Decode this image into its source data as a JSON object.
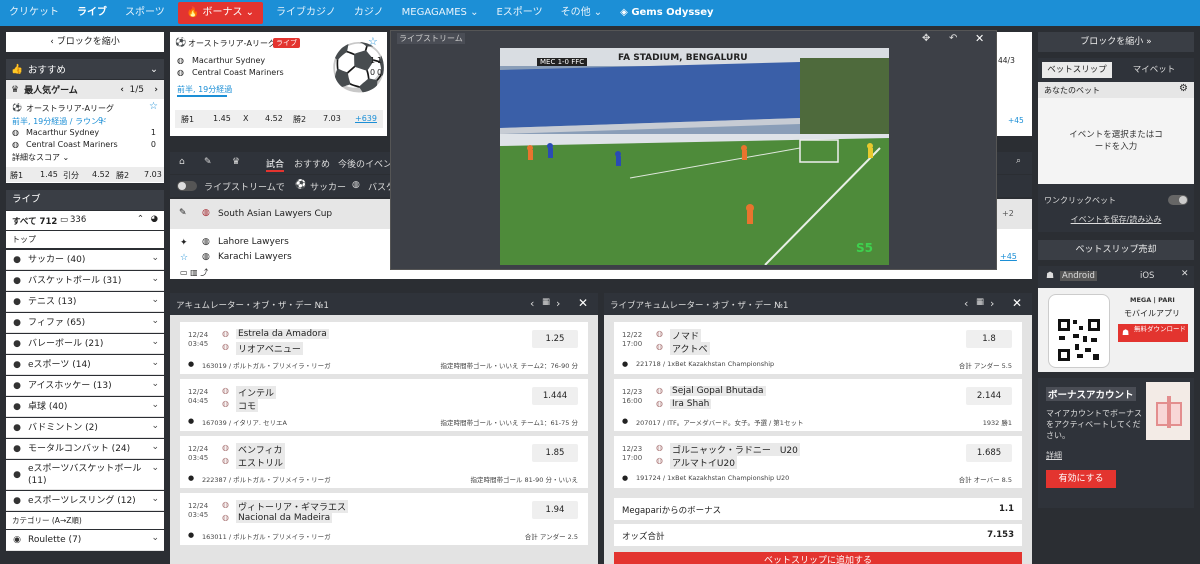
{
  "topnav": {
    "items": [
      "クリケット",
      "ライブ",
      "スポーツ",
      "ボーナス",
      "ライブカジノ",
      "カジノ",
      "MEGAGAMES",
      "Eスポーツ",
      "その他",
      "Gems Odyssey"
    ]
  },
  "left": {
    "shrink_label": "ブロックを縮小",
    "featured_label": "おすすめ",
    "popular_label": "最人気ゲーム",
    "popular_page": "1/5",
    "match": {
      "league": "オーストラリア-Aリーグ",
      "status": "前半, 19分経過 / ラウンド",
      "round": "9",
      "team1": "Macarthur Sydney",
      "team2": "Central Coast Mariners",
      "score1": "1",
      "score2": "0",
      "detail_label": "詳細なスコア",
      "odds": [
        {
          "l": "勝1",
          "v": "1.45"
        },
        {
          "l": "引分",
          "v": "4.52"
        },
        {
          "l": "勝2",
          "v": "7.03"
        }
      ]
    },
    "live_label": "ライブ",
    "all_label": "すべて 712",
    "all_count": "336",
    "top_label": "トップ",
    "sports": [
      {
        "icon": "soccer-icon",
        "label": "サッカー (40)"
      },
      {
        "icon": "basketball-icon",
        "label": "バスケットボール (31)"
      },
      {
        "icon": "tennis-icon",
        "label": "テニス (13)"
      },
      {
        "icon": "fifa-icon",
        "label": "フィファ (65)"
      },
      {
        "icon": "volleyball-icon",
        "label": "バレーボール (21)"
      },
      {
        "icon": "esports-icon",
        "label": "eスポーツ (14)"
      },
      {
        "icon": "icehockey-icon",
        "label": "アイスホッケー (13)"
      },
      {
        "icon": "tabletennis-icon",
        "label": "卓球 (40)"
      },
      {
        "icon": "badminton-icon",
        "label": "バドミントン (2)"
      },
      {
        "icon": "motorsport-icon",
        "label": "モータルコンバット (24)"
      },
      {
        "icon": "esports-basketball-icon",
        "label": "eスポーツバスケットボール (11)"
      },
      {
        "icon": "esports-wrestling-icon",
        "label": "eスポーツレスリング (12)"
      }
    ],
    "category_label": "カテゴリー (A→Z順)",
    "roulette_label": "Roulette (7)"
  },
  "featured": {
    "league": "オーストラリア-Aリーグ",
    "live_badge": "ライブ",
    "team1": "Macarthur Sydney",
    "team2": "Central Coast Mariners",
    "score1a": "1",
    "score1b": "1",
    "score2a": "0",
    "score2b": "0",
    "status": "前半, 19分経過",
    "odds": [
      {
        "l": "勝1",
        "v": "1.45"
      },
      {
        "l": "X",
        "v": "4.52"
      },
      {
        "l": "勝2",
        "v": "7.03"
      }
    ],
    "more": "+639",
    "right_score": "44/3",
    "right_more": "+45"
  },
  "video": {
    "label": "ライブストリーム",
    "scoreboard": "MEC  1-0  FFC",
    "stadium_text": "FA STADIUM, BENGALURU"
  },
  "mid": {
    "tabs": [
      "試合",
      "おすすめ",
      "今後のイベント"
    ],
    "stream_toggle": "ライブストリームで",
    "sport_tabs": [
      "サッカー",
      "バスケ"
    ],
    "league": "South Asian Lawyers Cup",
    "team1": "Lahore Lawyers",
    "team2": "Karachi Lawyers",
    "plus2": "+2",
    "plus45": "+45"
  },
  "acc1": {
    "title": "アキュムレーター・オブ・ザ・デー №1",
    "items": [
      {
        "date": "12/24",
        "time": "03:45",
        "t1": "Estrela da Amadora",
        "t2": "リオアベニュー",
        "odd": "1.25",
        "id": "163019 / ポルトガル・プリメイラ・リーガ",
        "bet": "指定時間帯ゴール・いいえ チーム2：76-90 分"
      },
      {
        "date": "12/24",
        "time": "04:45",
        "t1": "インテル",
        "t2": "コモ",
        "odd": "1.444",
        "id": "167039 / イタリア. セリエA",
        "bet": "指定時間帯ゴール・いいえ チーム1：61-75 分"
      },
      {
        "date": "12/24",
        "time": "03:45",
        "t1": "ベンフィカ",
        "t2": "エストリル",
        "odd": "1.85",
        "id": "222387 / ポルトガル・プリメイラ・リーガ",
        "bet": "指定時間帯ゴール 81-90 分・いいえ"
      },
      {
        "date": "12/24",
        "time": "03:45",
        "t1": "ヴィトーリア・ギマラエス",
        "t2": "Nacional da Madeira",
        "odd": "1.94",
        "id": "163011 / ポルトガル・プリメイラ・リーガ",
        "bet": "合計 アンダー 2.5"
      }
    ]
  },
  "acc2": {
    "title": "ライブアキュムレーター・オブ・ザ・デー №1",
    "items": [
      {
        "date": "12/22",
        "time": "17:00",
        "t1": "ノマド",
        "t2": "アクトベ",
        "odd": "1.8",
        "id": "221718 / 1xBet Kazakhstan Championship",
        "bet": "合計 アンダー 5.5"
      },
      {
        "date": "12/23",
        "time": "16:00",
        "t1": "Sejal Gopal Bhutada",
        "t2": "Ira Shah",
        "odd": "2.144",
        "id": "207017 / ITF。アーメダバード。女子。予選 / 第1セット",
        "bet": "1932 勝1"
      },
      {
        "date": "12/23",
        "time": "17:00",
        "t1": "ゴルニャック・ラドニー　U20",
        "t2": "アルマトイU20",
        "odd": "1.685",
        "id": "191724 / 1xBet Kazakhstan Championship U20",
        "bet": "合計 オーバー 8.5"
      }
    ],
    "bonus_label": "Megapariからのボーナス",
    "bonus_val": "1.1",
    "total_label": "オッズ合計",
    "total_val": "7.153",
    "add_button": "ベットスリップに追加する"
  },
  "right": {
    "shrink_label": "ブロックを縮小",
    "tabs": [
      "ベットスリップ",
      "マイベット"
    ],
    "your_bet": "あなたのベット",
    "empty": "イベントを選択またはコードを入力",
    "oneclick": "ワンクリックベット",
    "save_load": "イベントを保存/読み込み",
    "slip_sale": "ベットスリップ売却",
    "android": "Android",
    "ios": "iOS",
    "app_brand": "MEGA | PARI",
    "app_label": "モバイルアプリ",
    "download": "無料ダウンロード",
    "bonus_title": "ボーナスアカウント",
    "bonus_desc": "マイアカウントでボーナスをアクティベートしてください。",
    "detail": "詳細",
    "activate": "有効にする"
  }
}
